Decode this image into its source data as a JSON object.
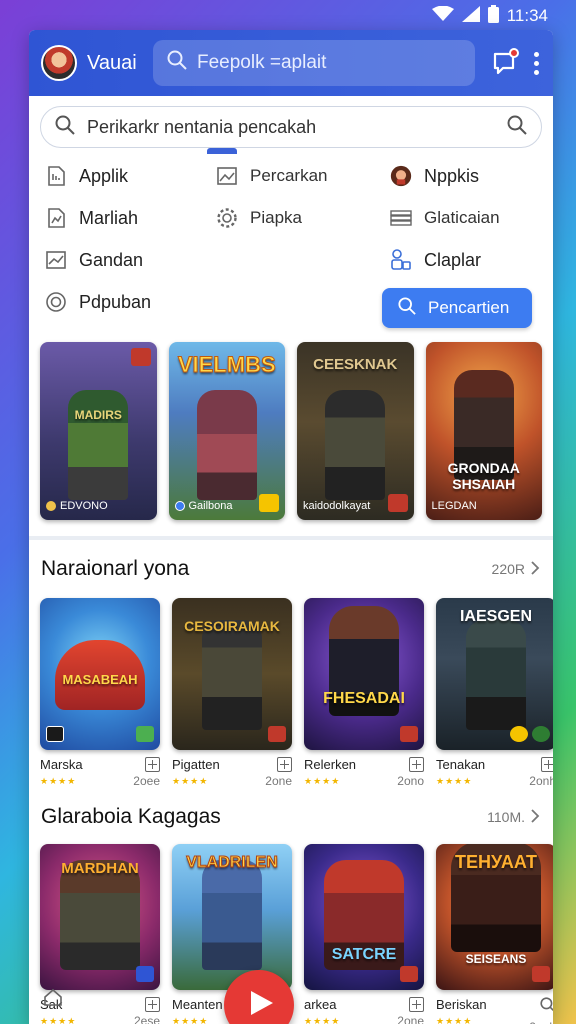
{
  "status": {
    "time": "11:34"
  },
  "header": {
    "app_name": "Vauai",
    "search_placeholder": "Feepolk =aplait"
  },
  "search": {
    "text": "Perikarkr nentania pencakah"
  },
  "categories": [
    {
      "label": "Applik",
      "icon": "app-icon"
    },
    {
      "label": "Percarkan",
      "icon": "image-icon"
    },
    {
      "label": "Nppkis",
      "icon": "avatar-icon"
    },
    {
      "label": "Marliah",
      "icon": "chart-icon"
    },
    {
      "label": "Piapka",
      "icon": "gear-icon"
    },
    {
      "label": "Glaticaian",
      "icon": "stack-icon"
    },
    {
      "label": "Gandan",
      "icon": "graph-icon"
    },
    {
      "label": "Claplar",
      "icon": "people-icon"
    },
    {
      "label": "Pdpuban",
      "icon": "circle-icon"
    }
  ],
  "search_button": {
    "label": "Pencartien"
  },
  "featured": [
    {
      "title": "MADIRS",
      "caption": "EDVONO"
    },
    {
      "title": "VIELMBS",
      "caption": "Gailbona"
    },
    {
      "title": "CEESKNAK",
      "caption": "kaidodolkayat"
    },
    {
      "title": "GRONDAA SHSAIAH",
      "caption": "LEGDAN"
    }
  ],
  "section1": {
    "title": "Naraionarl yona",
    "count": "220R",
    "games": [
      {
        "name": "Marska",
        "size": "2oee",
        "art": "MASABEAH"
      },
      {
        "name": "Pigatten",
        "size": "2one",
        "art": "CESOIRAMAK"
      },
      {
        "name": "Relerken",
        "size": "2ono",
        "art": "FHESADAI"
      },
      {
        "name": "Tenakan",
        "size": "2onh",
        "art": "IAESGEN"
      }
    ]
  },
  "section2": {
    "title": "Glaraboia Kagagas",
    "count": "110M.",
    "games": [
      {
        "name": "Sak",
        "size": "2ese",
        "art": "MARDHAN"
      },
      {
        "name": "Meanten",
        "size": "",
        "art": "VLADRILEN"
      },
      {
        "name": "arkea",
        "size": "2one",
        "art": "SATCRE"
      },
      {
        "name": "Beriskan",
        "size": "2onh",
        "art": "SEISEANS"
      }
    ]
  },
  "stars": "★★★★",
  "colors": {
    "primary": "#2f55d4",
    "accent": "#3d7cf1",
    "fab": "#e53935"
  }
}
